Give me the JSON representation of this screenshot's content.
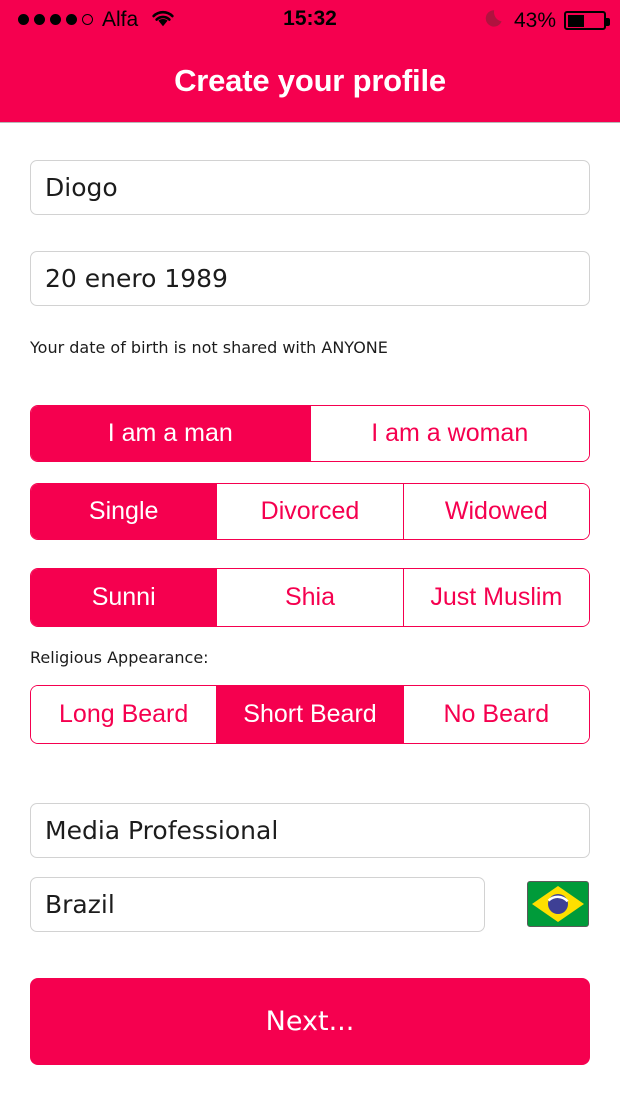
{
  "status_bar": {
    "signal_dots_filled": 4,
    "signal_dots_total": 5,
    "carrier": "Alfa",
    "wifi_icon": "wifi-icon",
    "time": "15:32",
    "moon_icon": "moon-icon",
    "battery_percent": "43%",
    "battery_level": 43
  },
  "header": {
    "title": "Create your profile",
    "background_color": "#f5004f"
  },
  "form": {
    "name_field": {
      "value": "Diogo",
      "placeholder": "Name"
    },
    "dob_field": {
      "value": "20 enero 1989",
      "placeholder": "Date of birth"
    },
    "dob_hint": "Your date of birth is not shared with ANYONE",
    "gender": {
      "options": [
        "I am a man",
        "I am a woman"
      ],
      "selected_index": 0
    },
    "marital_status": {
      "options": [
        "Single",
        "Divorced",
        "Widowed"
      ],
      "selected_index": 0
    },
    "religion": {
      "options": [
        "Sunni",
        "Shia",
        "Just Muslim"
      ],
      "selected_index": 0
    },
    "religious_appearance_label": "Religious Appearance:",
    "religious_appearance": {
      "options": [
        "Long Beard",
        "Short Beard",
        "No Beard"
      ],
      "selected_index": 1
    },
    "profession_field": {
      "value": "Media Professional",
      "placeholder": "Profession"
    },
    "country_field": {
      "value": "Brazil",
      "placeholder": "Country"
    },
    "country_flag": {
      "icon": "brazil-flag-icon",
      "green": "#009b3a",
      "yellow": "#fedf00",
      "blue": "#3e4095"
    },
    "next_button": "Next..."
  },
  "colors": {
    "accent": "#f5004f",
    "field_border": "#d2d2d2",
    "text": "#1c1c1c"
  }
}
